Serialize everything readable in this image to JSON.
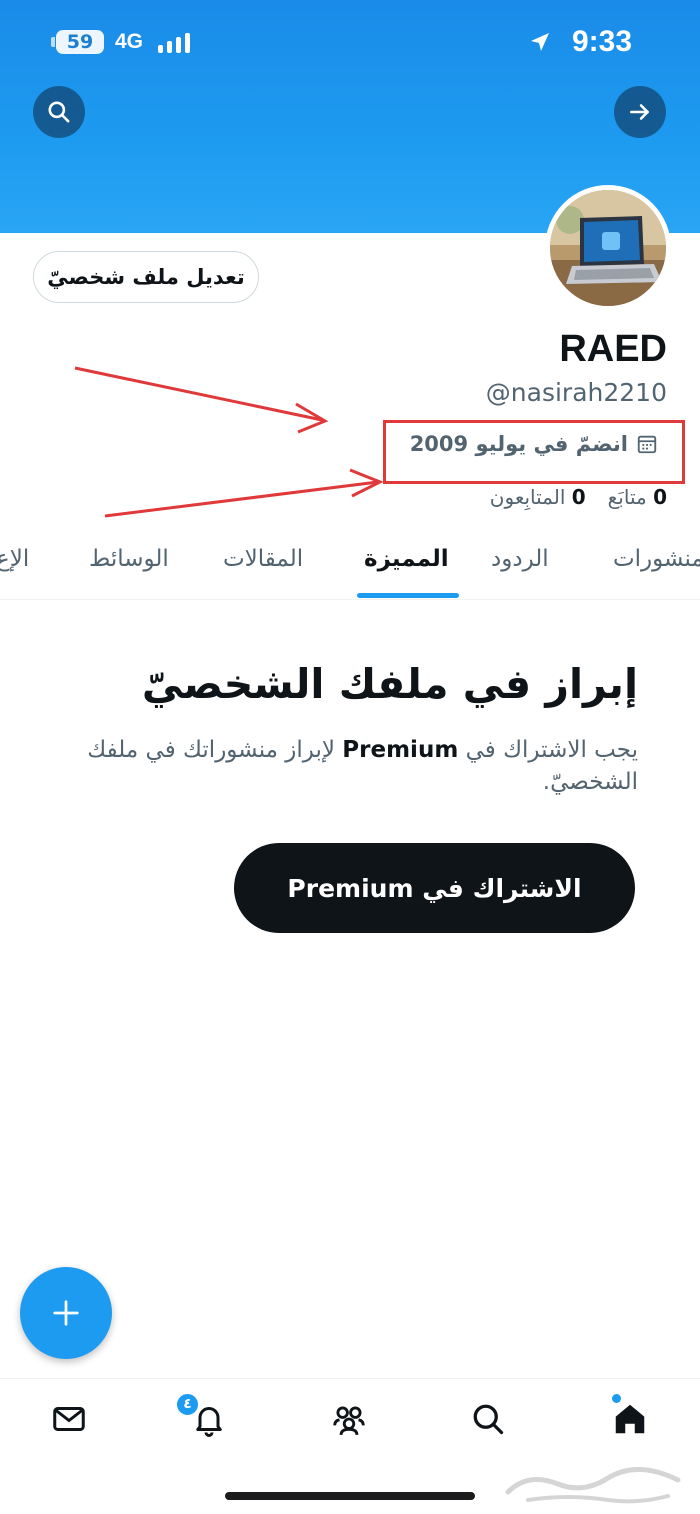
{
  "status_bar": {
    "battery": "59",
    "network": "4G",
    "time": "9:33"
  },
  "header": {
    "search_icon": "search-icon",
    "forward_icon": "arrow-right-icon"
  },
  "profile": {
    "edit_button": "تعديل ملف شخصيّ",
    "display_name": "RAED",
    "handle": "@nasirah2210",
    "joined": "انضمّ في يوليو 2009",
    "following_count": "0",
    "following_label": "متابَع",
    "followers_count": "0",
    "followers_label": "المتابِعون"
  },
  "tabs": [
    {
      "label": "منشورات",
      "active": false
    },
    {
      "label": "الردود",
      "active": false
    },
    {
      "label": "المميزة",
      "active": true
    },
    {
      "label": "المقالات",
      "active": false
    },
    {
      "label": "الوسائط",
      "active": false
    },
    {
      "label": "الإع",
      "active": false
    }
  ],
  "highlights": {
    "title": "إبراز في ملفك الشخصيّ",
    "desc_before": "يجب الاشتراك في",
    "desc_brand": "Premium",
    "desc_after": "لإبراز منشوراتك في ملفك الشخصيّ.",
    "subscribe_button": "الاشتراك في Premium"
  },
  "bottom_nav": {
    "notification_badge": "٤",
    "items": [
      "mail-icon",
      "bell-icon",
      "communities-icon",
      "search-icon",
      "home-icon"
    ]
  },
  "colors": {
    "accent": "#1d9bf0",
    "annotation": "#e0393a",
    "dark": "#0f1419"
  }
}
